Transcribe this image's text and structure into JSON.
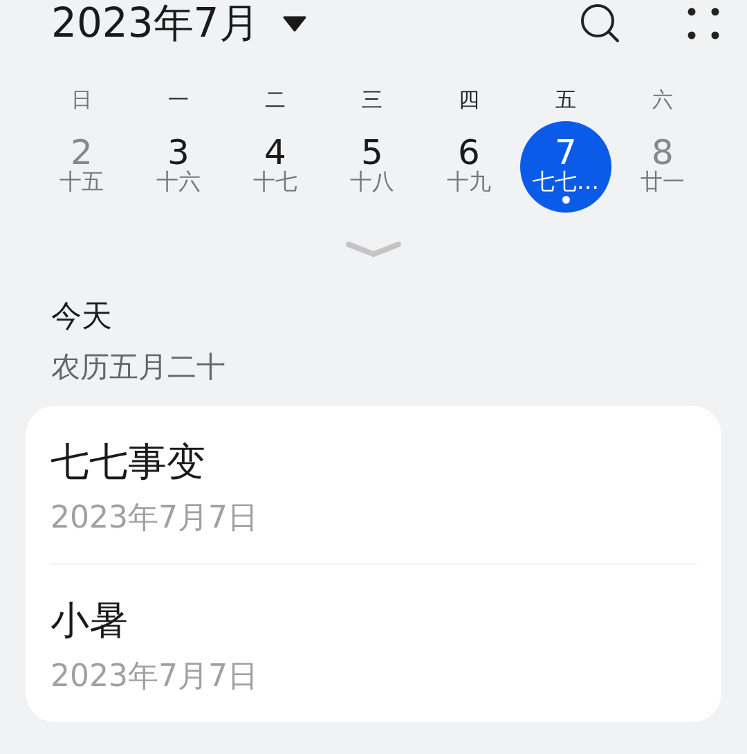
{
  "header": {
    "title": "2023年7月"
  },
  "weekdays": [
    {
      "label": "日",
      "weekend": true
    },
    {
      "label": "一",
      "weekend": false
    },
    {
      "label": "二",
      "weekend": false
    },
    {
      "label": "三",
      "weekend": false
    },
    {
      "label": "四",
      "weekend": false
    },
    {
      "label": "五",
      "weekend": false
    },
    {
      "label": "六",
      "weekend": true
    }
  ],
  "days": [
    {
      "day": "2",
      "lunar": "十五",
      "weekend": true,
      "selected": false,
      "has_event": false
    },
    {
      "day": "3",
      "lunar": "十六",
      "weekend": false,
      "selected": false,
      "has_event": false
    },
    {
      "day": "4",
      "lunar": "十七",
      "weekend": false,
      "selected": false,
      "has_event": false
    },
    {
      "day": "5",
      "lunar": "十八",
      "weekend": false,
      "selected": false,
      "has_event": false
    },
    {
      "day": "6",
      "lunar": "十九",
      "weekend": false,
      "selected": false,
      "has_event": false
    },
    {
      "day": "7",
      "lunar": "七七…",
      "weekend": false,
      "selected": true,
      "has_event": true
    },
    {
      "day": "8",
      "lunar": "廿一",
      "weekend": true,
      "selected": false,
      "has_event": false
    }
  ],
  "today": {
    "label": "今天",
    "lunar_date": "农历五月二十"
  },
  "events": [
    {
      "title": "七七事变",
      "date": "2023年7月7日"
    },
    {
      "title": "小暑",
      "date": "2023年7月7日"
    }
  ]
}
